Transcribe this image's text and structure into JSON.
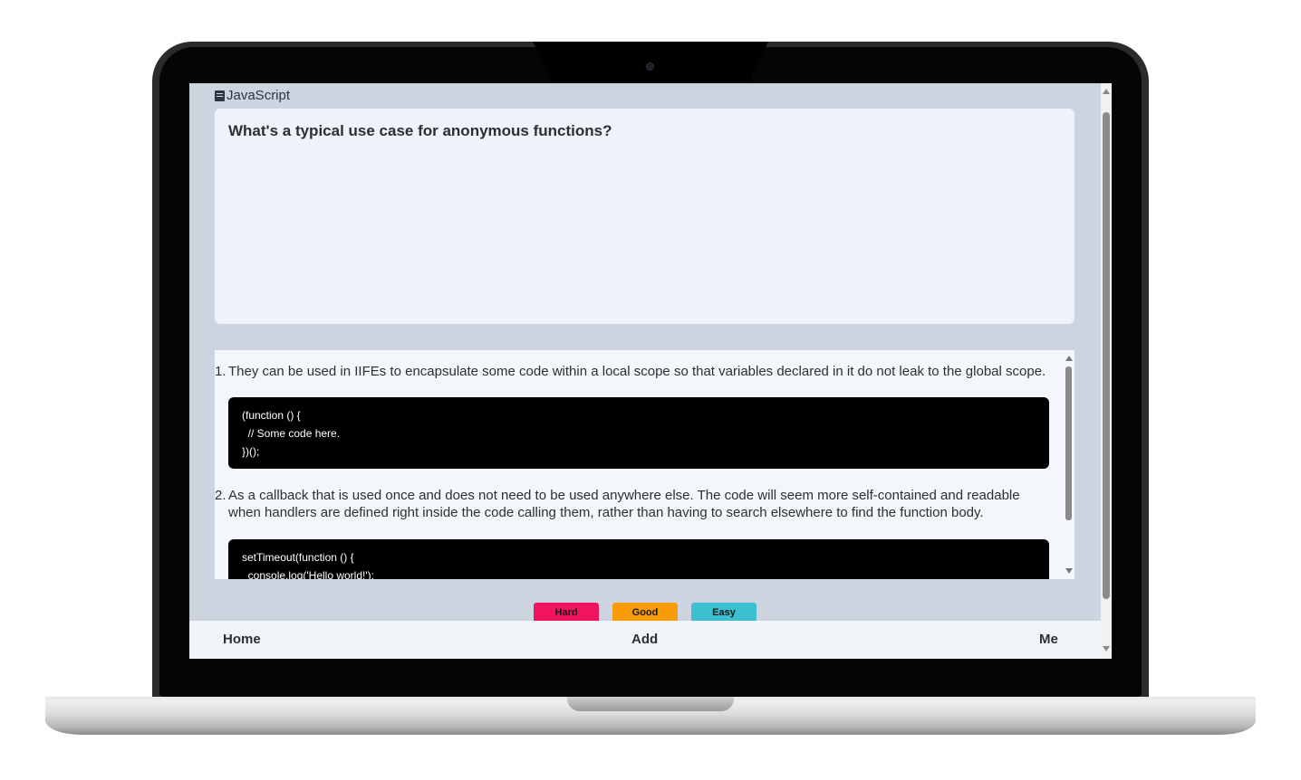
{
  "deck": {
    "name": "JavaScript",
    "icon": "book-icon"
  },
  "question": {
    "text": "What's a typical use case for anonymous functions?"
  },
  "answers": [
    {
      "number": "1.",
      "text": "They can be used in IIFEs to encapsulate some code within a local scope so that variables declared in it do not leak to the global scope.",
      "code": "(function () {\n  // Some code here.\n})();"
    },
    {
      "number": "2.",
      "text": "As a callback that is used once and does not need to be used anywhere else. The code will seem more self-contained and readable when handlers are defined right inside the code calling them, rather than having to search elsewhere to find the function body.",
      "code": "setTimeout(function () {\n  console.log('Hello world!');"
    }
  ],
  "rating": {
    "hard": "Hard",
    "good": "Good",
    "easy": "Easy"
  },
  "colors": {
    "hard": "#f0145f",
    "good": "#f79b07",
    "easy": "#3bbfd1"
  },
  "nav": {
    "home": "Home",
    "add": "Add",
    "me": "Me"
  }
}
